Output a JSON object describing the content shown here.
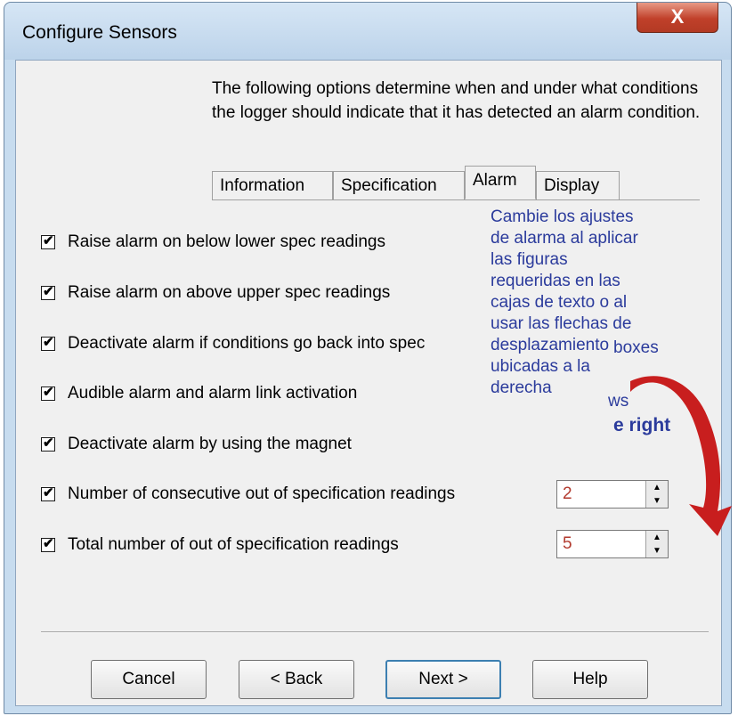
{
  "window": {
    "title": "Configure Sensors",
    "close_label": "X"
  },
  "description": "The following options determine when and under what conditions the logger should indicate that it has detected an alarm condition.",
  "tabs": [
    {
      "label": "Information",
      "active": false
    },
    {
      "label": "Specification",
      "active": false
    },
    {
      "label": "Alarm",
      "active": true
    },
    {
      "label": "Display",
      "active": false
    }
  ],
  "options": [
    {
      "label": "Raise alarm on below lower spec readings",
      "checked": true
    },
    {
      "label": "Raise alarm on above upper spec readings",
      "checked": true
    },
    {
      "label": "Deactivate alarm if conditions go back into spec",
      "checked": true
    },
    {
      "label": "Audible alarm and alarm link activation",
      "checked": true
    },
    {
      "label": "Deactivate alarm by using the magnet",
      "checked": true
    },
    {
      "label": "Number of consecutive out of specification readings",
      "checked": true,
      "value": "2"
    },
    {
      "label": "Total number of out of specification readings",
      "checked": true,
      "value": "5"
    }
  ],
  "check_mark": "✔",
  "buttons": {
    "cancel": "Cancel",
    "back": "< Back",
    "next": "Next >",
    "help": "Help"
  },
  "annotation": {
    "lines": [
      "Cambie los ajustes",
      "de alarma al aplicar",
      "las figuras",
      "requeridas en las",
      "cajas de texto o al",
      "usar las flechas de",
      "desplazamiento",
      "ubicadas a la",
      "derecha"
    ],
    "ghost_boxes": "boxes",
    "ghost_ws": "ws",
    "ghost_right": "e right",
    "text_color": "#2b3b9c",
    "arrow_color": "#c81e1e"
  }
}
